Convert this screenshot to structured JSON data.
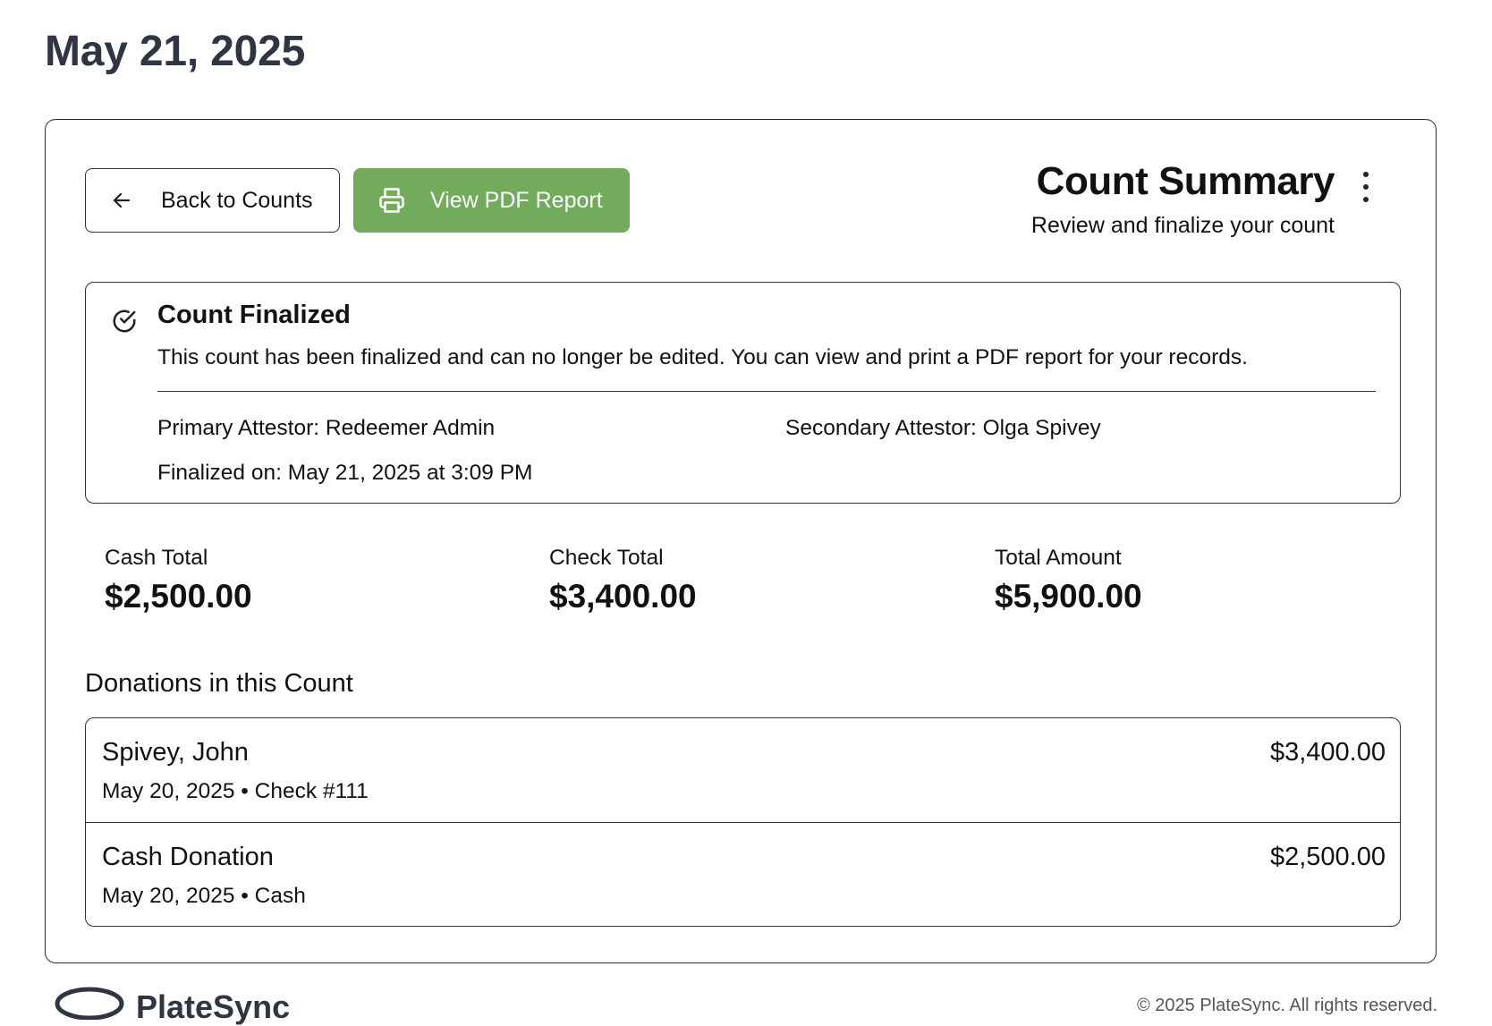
{
  "page": {
    "date_title": "May 21, 2025"
  },
  "toolbar": {
    "back_label": "Back to Counts",
    "pdf_label": "View PDF Report",
    "pdf_color": "#72ab5c"
  },
  "summary": {
    "title": "Count Summary",
    "subtitle": "Review and finalize your count"
  },
  "status": {
    "title": "Count Finalized",
    "message": "This count has been finalized and can no longer be edited. You can view and print a PDF report for your records.",
    "primary_attestor": "Primary Attestor: Redeemer Admin",
    "secondary_attestor": "Secondary Attestor: Olga Spivey",
    "finalized_on": "Finalized on: May 21, 2025 at 3:09 PM"
  },
  "totals": [
    {
      "label": "Cash Total",
      "value": "$2,500.00"
    },
    {
      "label": "Check Total",
      "value": "$3,400.00"
    },
    {
      "label": "Total Amount",
      "value": "$5,900.00"
    }
  ],
  "donations": {
    "heading": "Donations in this Count",
    "items": [
      {
        "name": "Spivey, John",
        "meta": "May 20, 2025 • Check #111",
        "amount": "$3,400.00"
      },
      {
        "name": "Cash Donation",
        "meta": "May 20, 2025 • Cash",
        "amount": "$2,500.00"
      }
    ]
  },
  "footer": {
    "brand": "PlateSync",
    "copyright": "© 2025 PlateSync. All rights reserved."
  },
  "icons": {
    "back": "arrow-left-icon",
    "pdf": "printer-icon",
    "status": "check-circle-icon",
    "menu": "more-vertical-icon"
  }
}
